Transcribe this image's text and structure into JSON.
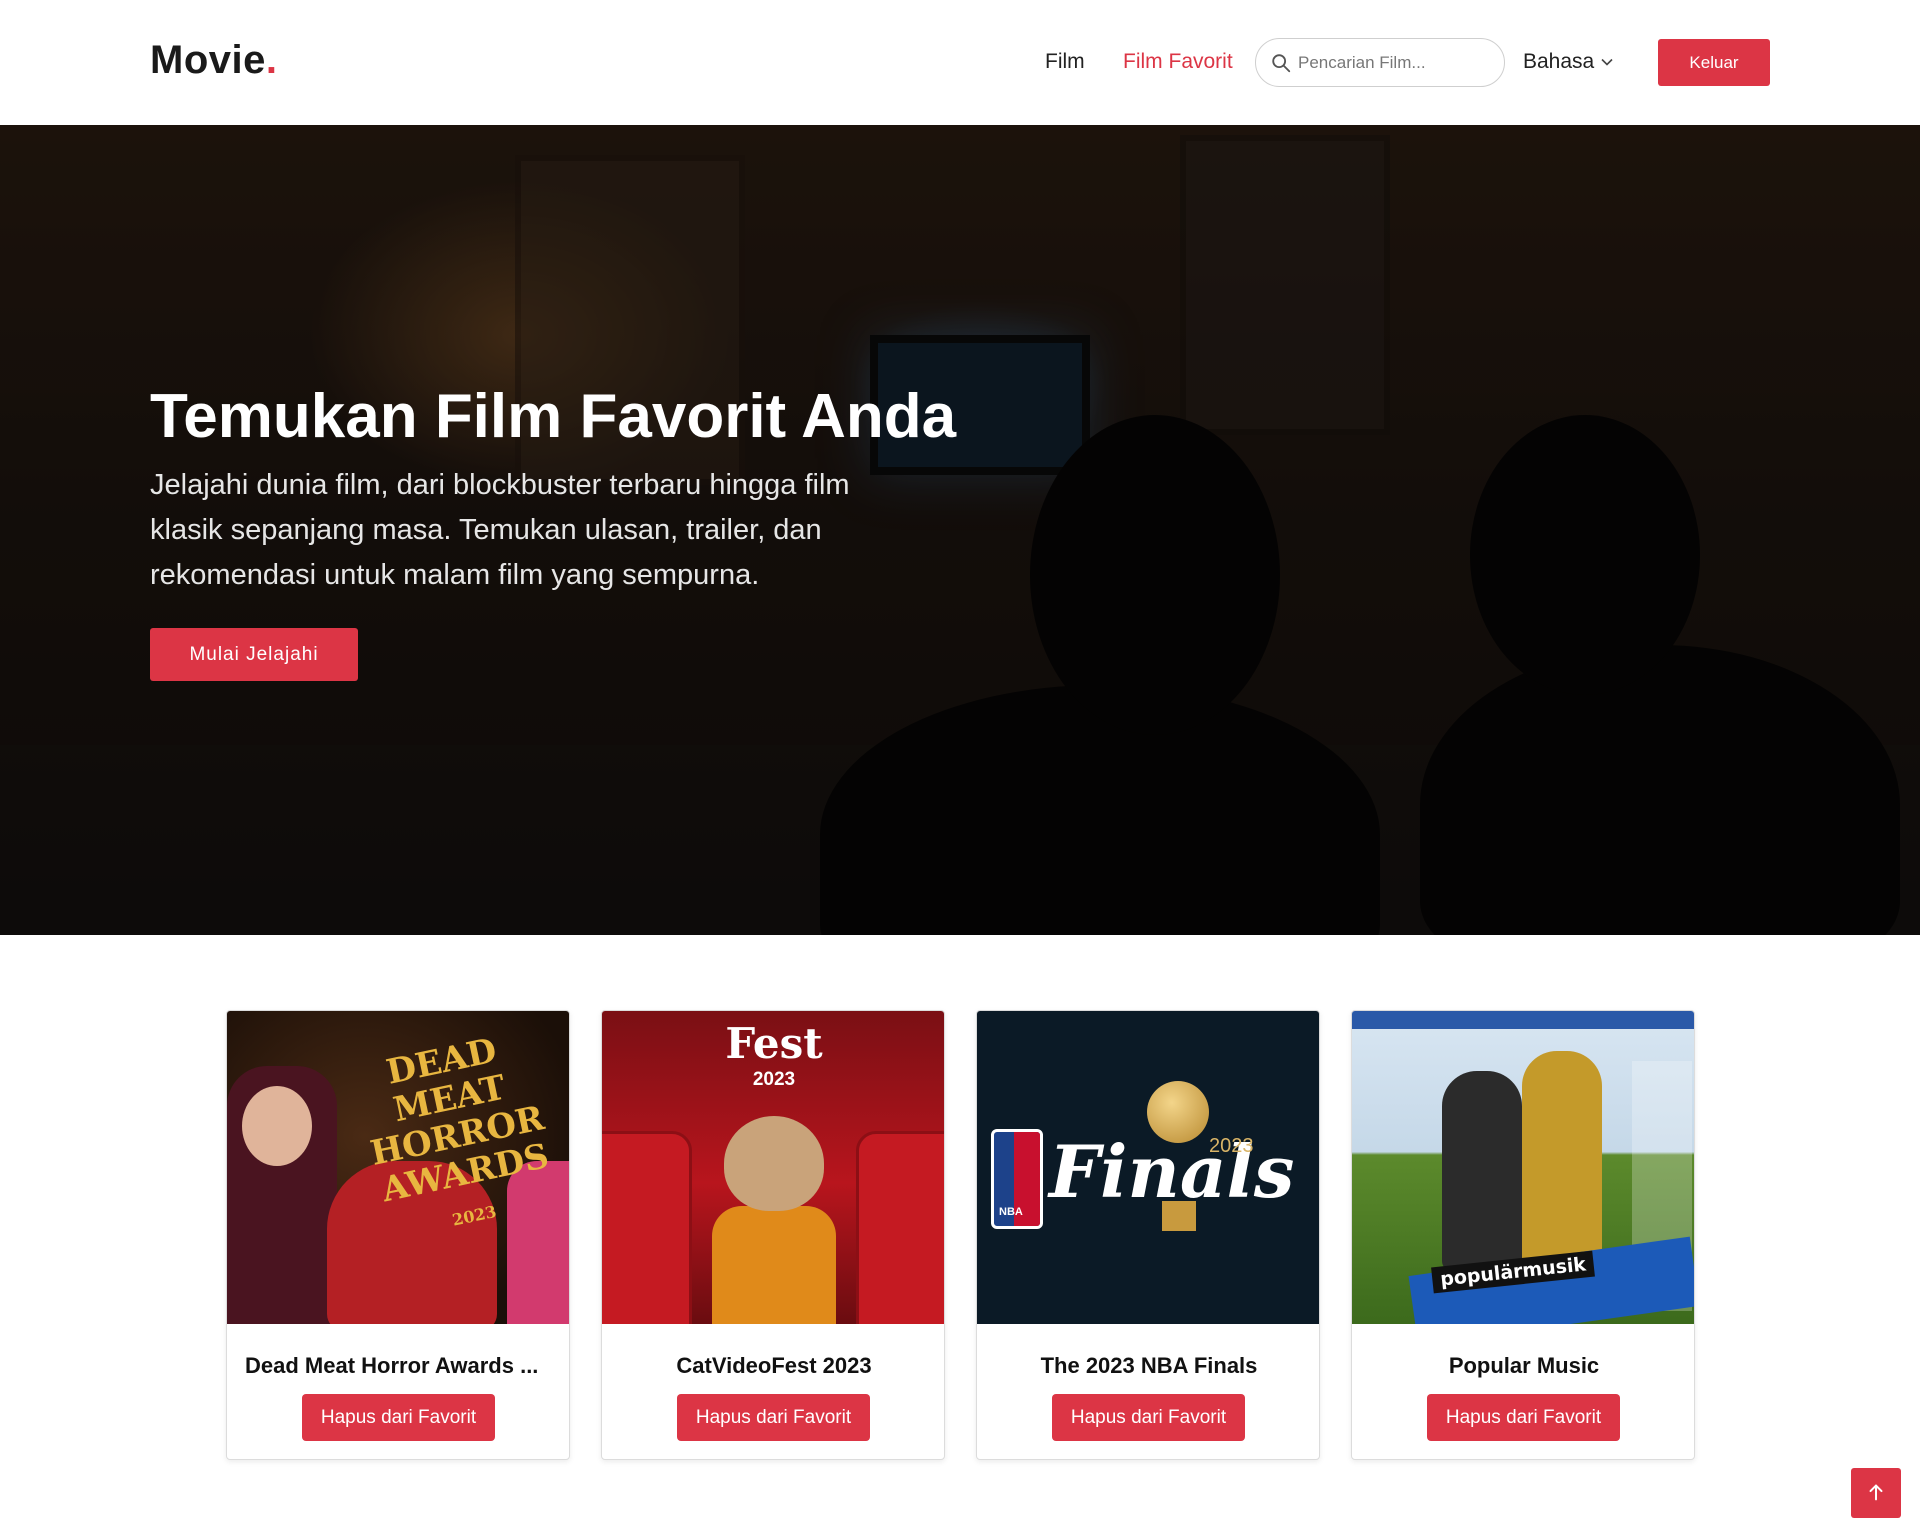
{
  "header": {
    "logo_text": "Movie",
    "logo_dot": ".",
    "nav": [
      {
        "label": "Film"
      },
      {
        "label": "Film Favorit"
      }
    ],
    "search_placeholder": "Pencarian Film...",
    "language_label": "Bahasa",
    "logout_label": "Keluar"
  },
  "hero": {
    "title": "Temukan Film Favorit Anda",
    "description": "Jelajahi dunia film, dari blockbuster terbaru hingga film klasik sepanjang masa. Temukan ulasan, trailer, dan rekomendasi untuk malam film yang sempurna.",
    "cta_label": "Mulai Jelajahi"
  },
  "favorites": [
    {
      "title": "Dead Meat Horror Awards ...",
      "button": "Hapus dari Favorit",
      "poster_text": [
        "DEAD",
        "MEAT",
        "HORROR",
        "AWARDS",
        "2023"
      ]
    },
    {
      "title": "CatVideoFest 2023",
      "button": "Hapus dari Favorit",
      "poster_text": [
        "Fest",
        "2023"
      ]
    },
    {
      "title": "The 2023 NBA Finals",
      "button": "Hapus dari Favorit",
      "poster_text": [
        "Finals",
        "2023",
        "NBA"
      ]
    },
    {
      "title": "Popular Music",
      "button": "Hapus dari Favorit",
      "poster_text": [
        "populärmusik"
      ]
    }
  ],
  "colors": {
    "accent": "#dc3545",
    "text": "#111111",
    "nav_active": "#dc3545"
  },
  "icons": {
    "search": "search-icon",
    "language": "chevron-down-icon",
    "back_to_top": "arrow-up-icon"
  }
}
